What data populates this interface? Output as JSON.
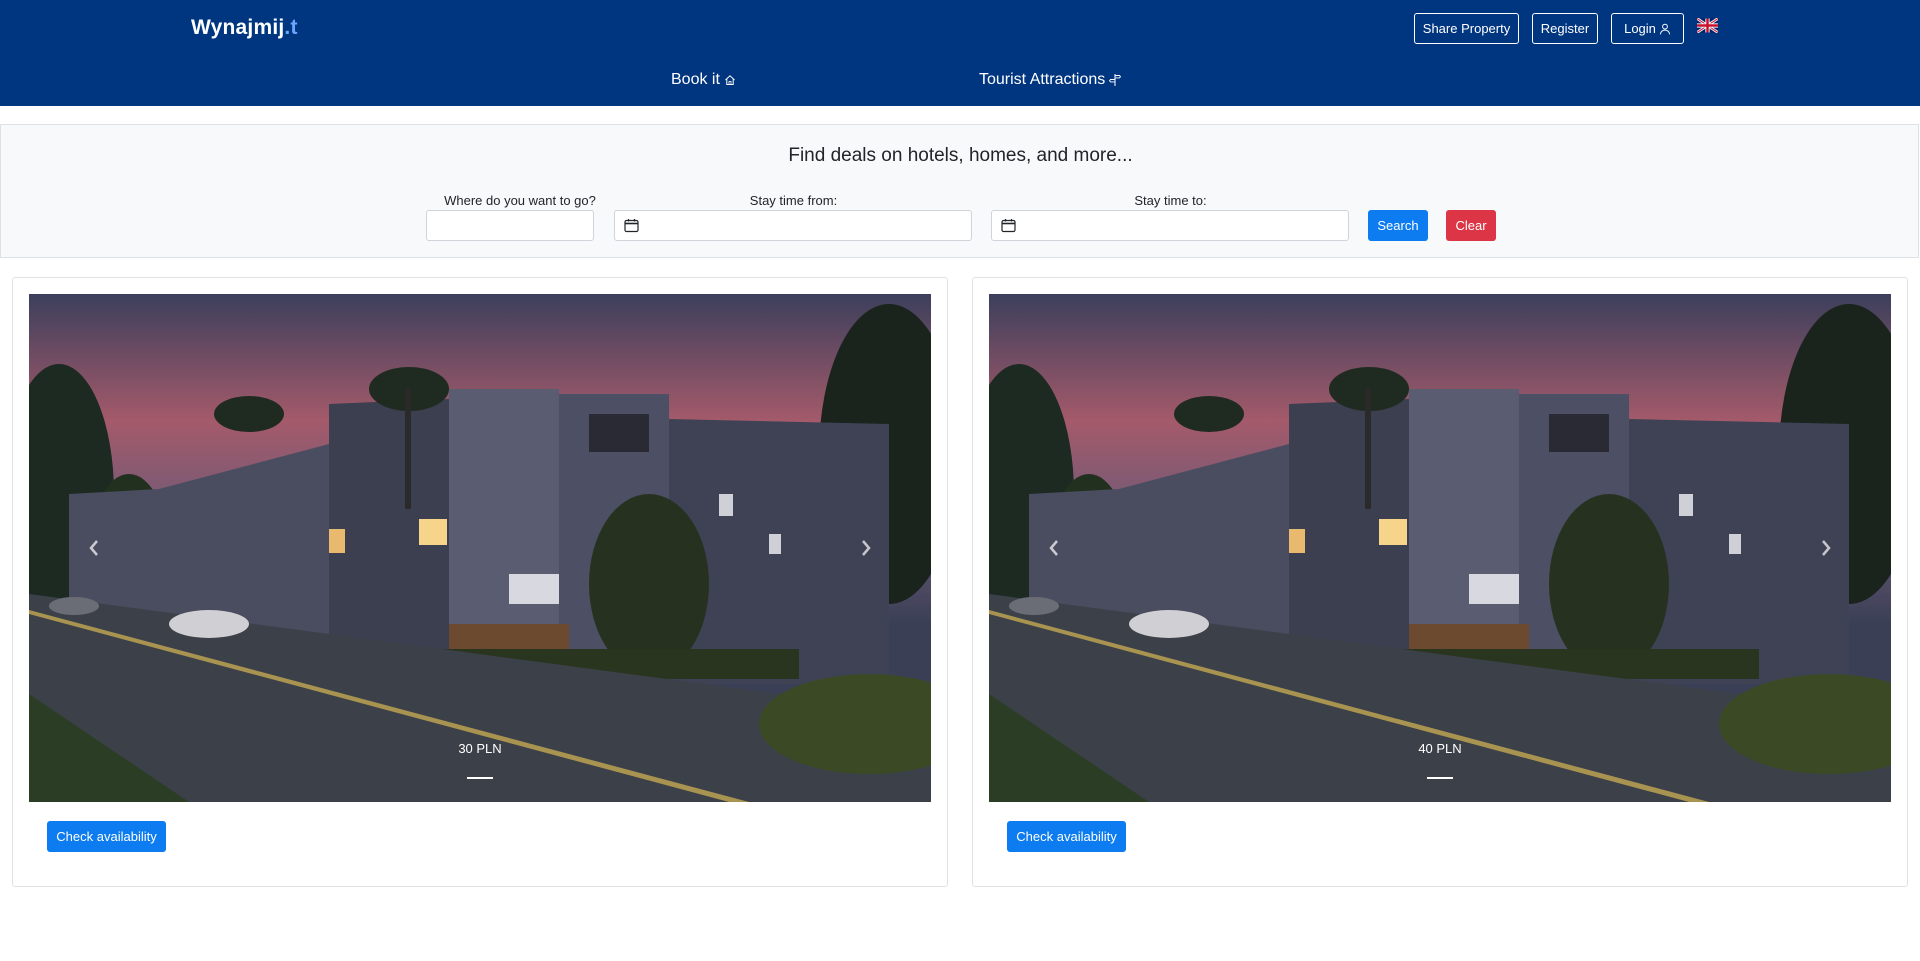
{
  "header": {
    "logo_main": "Wynajmij",
    "logo_accent": ".t",
    "share_label": "Share Property",
    "register_label": "Register",
    "login_label": "Login",
    "language_icon": "uk-flag-icon",
    "menu": [
      {
        "label": "Book it",
        "icon": "home-icon"
      },
      {
        "label": "Tourist Attractions",
        "icon": "signpost-icon"
      }
    ]
  },
  "search": {
    "title": "Find deals on hotels, homes, and more...",
    "where_label": "Where do you want to go?",
    "where_value": "",
    "from_label": "Stay time from:",
    "from_value": "",
    "to_label": "Stay time to:",
    "to_value": "",
    "search_label": "Search",
    "clear_label": "Clear"
  },
  "listings": [
    {
      "price": "30 PLN",
      "button_label": "Check availability"
    },
    {
      "price": "40 PLN",
      "button_label": "Check availability"
    }
  ],
  "colors": {
    "navbar": "#003580",
    "primary": "#0d7cf0",
    "danger": "#dc3545",
    "panel": "#f8f9fa"
  }
}
